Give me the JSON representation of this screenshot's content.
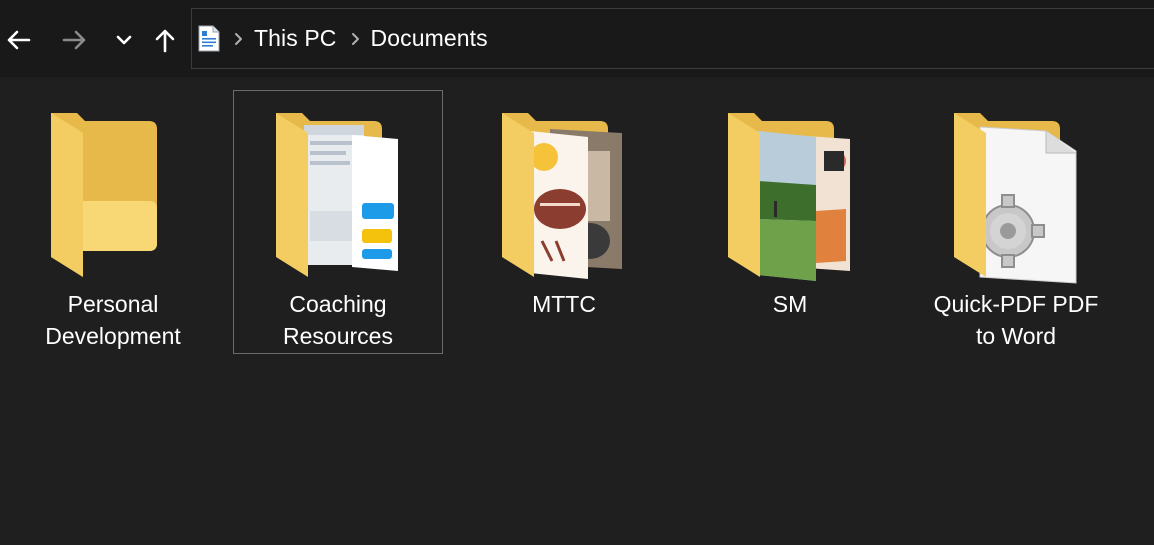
{
  "nav": {
    "back_icon": "arrow-left-icon",
    "forward_icon": "arrow-right-icon",
    "recent_icon": "chevron-down-icon",
    "up_icon": "arrow-up-icon"
  },
  "breadcrumb": {
    "location_icon": "documents-icon",
    "items": [
      "This PC",
      "Documents"
    ]
  },
  "folders": [
    {
      "name": "Personal\nDevelopment",
      "selected": false
    },
    {
      "name": "Coaching\nResources",
      "selected": true
    },
    {
      "name": "MTTC",
      "selected": false
    },
    {
      "name": "SM",
      "selected": false
    },
    {
      "name": "Quick-PDF PDF\nto Word",
      "selected": false
    }
  ],
  "colors": {
    "folder_back": "#e6b94a",
    "folder_front": "#f8d775",
    "background": "#1f1f1f",
    "toolbar": "#191919"
  }
}
